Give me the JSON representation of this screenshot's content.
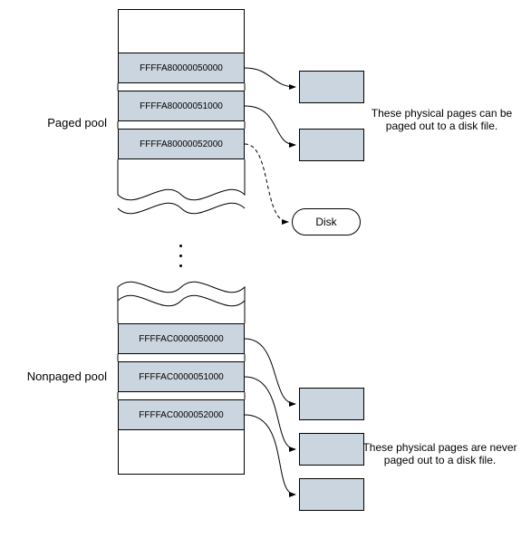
{
  "paged": {
    "label": "Paged pool",
    "cells": [
      "FFFFA80000050000",
      "FFFFA80000051000",
      "FFFFA80000052000"
    ],
    "caption": "These physical pages can be paged out to a disk file.",
    "disk_label": "Disk"
  },
  "nonpaged": {
    "label": "Nonpaged pool",
    "cells": [
      "FFFFAC0000050000",
      "FFFFAC0000051000",
      "FFFFAC0000052000"
    ],
    "caption": "These physical pages are never paged out to a disk file."
  }
}
